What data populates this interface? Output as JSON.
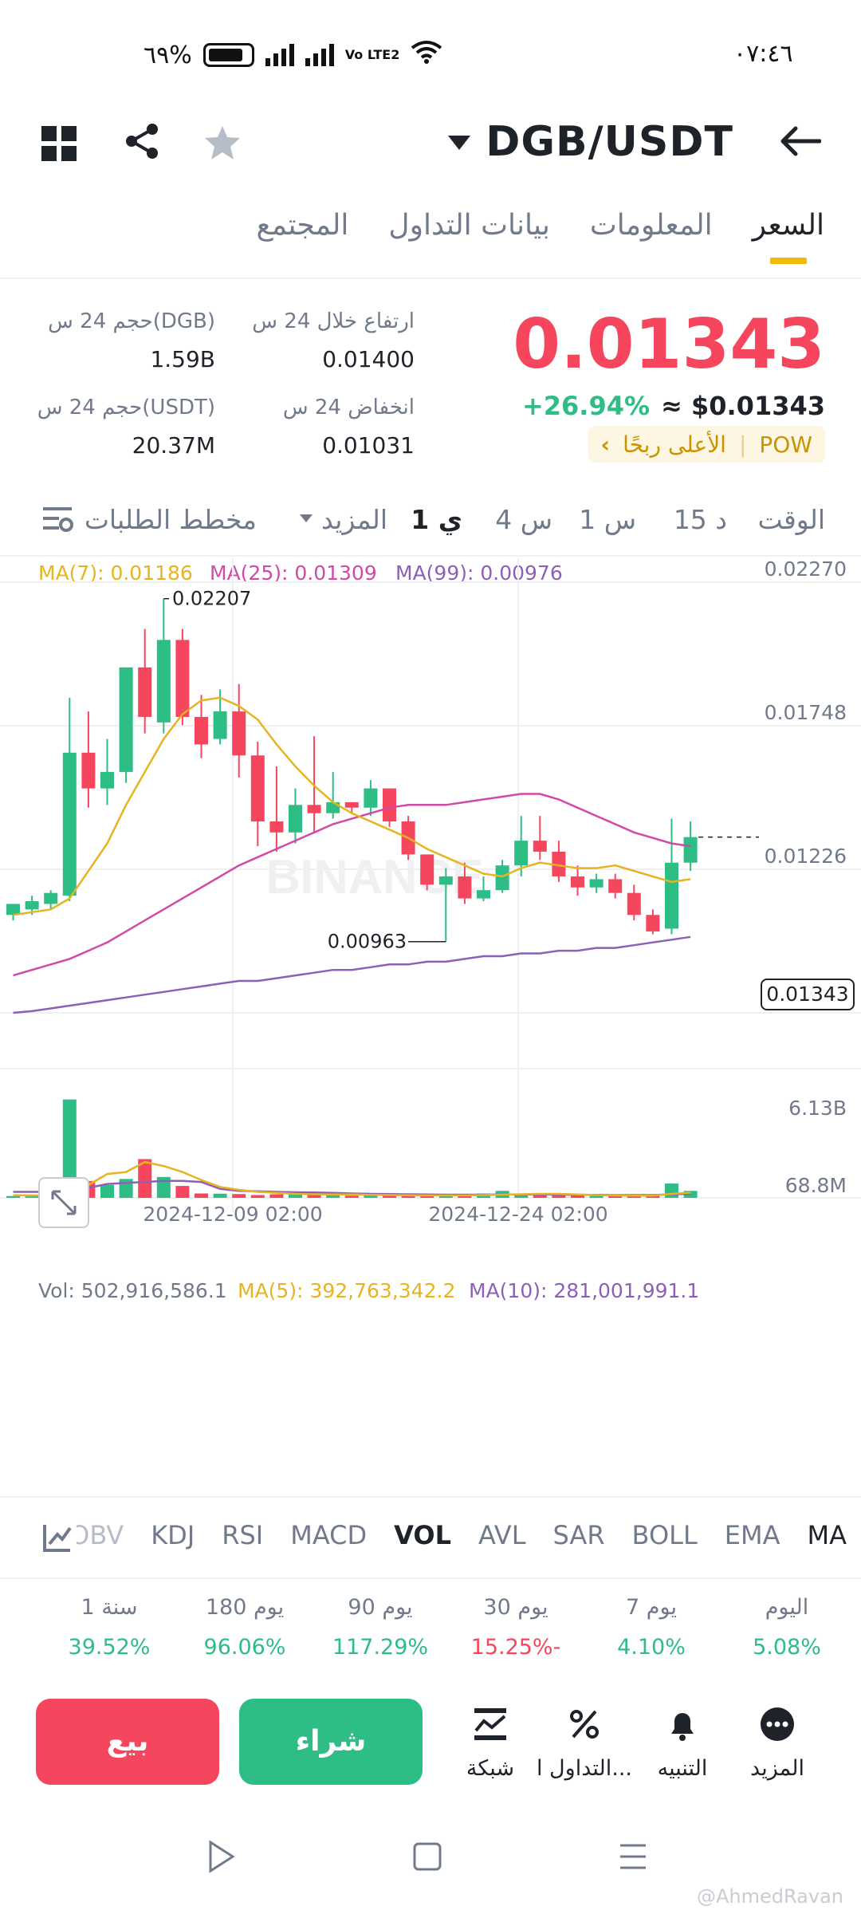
{
  "status_bar": {
    "time": "٠٧:٤٦",
    "battery": "٦٩%",
    "network": "Vo LTE2"
  },
  "header": {
    "pair": "DGB/USDT",
    "icons": [
      "back-arrow-icon",
      "dropdown-caret-icon",
      "favorite-star-icon",
      "share-icon",
      "grid-menu-icon"
    ]
  },
  "tabs": [
    {
      "label": "السعر",
      "active": true
    },
    {
      "label": "المعلومات",
      "active": false
    },
    {
      "label": "بيانات التداول",
      "active": false
    },
    {
      "label": "المجتمع",
      "active": false
    }
  ],
  "price": {
    "last": "0.01343",
    "change_pct": "+26.94%",
    "usd": "≈ $0.01343",
    "tag_pow": "POW",
    "tag_gainers": "الأعلى ربحًا",
    "tag_arrow": "‹"
  },
  "stats": {
    "high_label": "ارتفاع خلال 24 س",
    "high_value": "0.01400",
    "low_label": "انخفاض 24 س",
    "low_value": "0.01031",
    "vol_base_label": "حجم 24 س(DGB)",
    "vol_base_value": "1.59B",
    "vol_quote_label": "حجم 24 س(USDT)",
    "vol_quote_value": "20.37M"
  },
  "timeframes": {
    "label": "الوقت",
    "items": [
      "15 د",
      "1 س",
      "4 س",
      "1 ي"
    ],
    "active": "1 ي",
    "more": "المزيد",
    "depth": "مخطط الطلبات"
  },
  "ma_legend": {
    "ma7": "MA(7): 0.01186",
    "ma25": "MA(25): 0.01309",
    "ma99": "MA(99): 0.00976"
  },
  "vol_legend": {
    "vol": "Vol: 502,916,586.1",
    "ma5": "MA(5): 392,763,342.2",
    "ma10": "MA(10): 281,001,991.1"
  },
  "colors": {
    "up": "#2ebd85",
    "down": "#f6465d",
    "ma7": "#e6b422",
    "ma25": "#d04aa6",
    "ma99": "#8e5fb8",
    "accent": "#f0b90b"
  },
  "chart_data": {
    "type": "candlestick",
    "y_axis_ticks": [
      "0.02270",
      "0.01748",
      "0.01226",
      "0.00704"
    ],
    "ylim": [
      0.00704,
      0.0227
    ],
    "x_ticks": [
      "2024-12-09 02:00",
      "2024-12-24 02:00"
    ],
    "annotations": {
      "max": "0.02207",
      "min": "0.00963"
    },
    "last_price_tag": "0.01343",
    "candles": [
      {
        "o": 0.0106,
        "h": 0.011,
        "c": 0.011,
        "l": 0.0104
      },
      {
        "o": 0.0108,
        "h": 0.0113,
        "c": 0.0111,
        "l": 0.0106
      },
      {
        "o": 0.011,
        "h": 0.0115,
        "c": 0.0114,
        "l": 0.0108
      },
      {
        "o": 0.0113,
        "h": 0.0185,
        "c": 0.0165,
        "l": 0.0111
      },
      {
        "o": 0.0165,
        "h": 0.018,
        "c": 0.0152,
        "l": 0.0145
      },
      {
        "o": 0.0152,
        "h": 0.017,
        "c": 0.0158,
        "l": 0.0146
      },
      {
        "o": 0.0158,
        "h": 0.0196,
        "c": 0.0196,
        "l": 0.0154
      },
      {
        "o": 0.0196,
        "h": 0.021,
        "c": 0.0178,
        "l": 0.0172
      },
      {
        "o": 0.0176,
        "h": 0.0221,
        "c": 0.0206,
        "l": 0.0172
      },
      {
        "o": 0.0206,
        "h": 0.021,
        "c": 0.0178,
        "l": 0.0175
      },
      {
        "o": 0.0178,
        "h": 0.0186,
        "c": 0.0168,
        "l": 0.0163
      },
      {
        "o": 0.017,
        "h": 0.0188,
        "c": 0.018,
        "l": 0.0168
      },
      {
        "o": 0.018,
        "h": 0.019,
        "c": 0.0164,
        "l": 0.0156
      },
      {
        "o": 0.0164,
        "h": 0.0169,
        "c": 0.014,
        "l": 0.0131
      },
      {
        "o": 0.014,
        "h": 0.016,
        "c": 0.0136,
        "l": 0.0129
      },
      {
        "o": 0.0136,
        "h": 0.0152,
        "c": 0.0146,
        "l": 0.0132
      },
      {
        "o": 0.0146,
        "h": 0.0171,
        "c": 0.0143,
        "l": 0.0136
      },
      {
        "o": 0.0143,
        "h": 0.0158,
        "c": 0.0147,
        "l": 0.0141
      },
      {
        "o": 0.0147,
        "h": 0.0146,
        "c": 0.0145,
        "l": 0.0143
      },
      {
        "o": 0.0145,
        "h": 0.0155,
        "c": 0.0152,
        "l": 0.0142
      },
      {
        "o": 0.0152,
        "h": 0.0152,
        "c": 0.014,
        "l": 0.0138
      },
      {
        "o": 0.014,
        "h": 0.0142,
        "c": 0.0128,
        "l": 0.0126
      },
      {
        "o": 0.0128,
        "h": 0.0127,
        "c": 0.0117,
        "l": 0.0115
      },
      {
        "o": 0.0117,
        "h": 0.0123,
        "c": 0.012,
        "l": 0.00963
      },
      {
        "o": 0.012,
        "h": 0.0125,
        "c": 0.0112,
        "l": 0.011
      },
      {
        "o": 0.0112,
        "h": 0.012,
        "c": 0.0115,
        "l": 0.0111
      },
      {
        "o": 0.0115,
        "h": 0.0126,
        "c": 0.0124,
        "l": 0.0114
      },
      {
        "o": 0.0124,
        "h": 0.0142,
        "c": 0.0133,
        "l": 0.012
      },
      {
        "o": 0.0133,
        "h": 0.0142,
        "c": 0.0129,
        "l": 0.0126
      },
      {
        "o": 0.0129,
        "h": 0.0133,
        "c": 0.012,
        "l": 0.0118
      },
      {
        "o": 0.012,
        "h": 0.0124,
        "c": 0.0116,
        "l": 0.0113
      },
      {
        "o": 0.0116,
        "h": 0.0121,
        "c": 0.0119,
        "l": 0.0114
      },
      {
        "o": 0.0119,
        "h": 0.0121,
        "c": 0.0114,
        "l": 0.0112
      },
      {
        "o": 0.0114,
        "h": 0.0117,
        "c": 0.0106,
        "l": 0.0104
      },
      {
        "o": 0.0106,
        "h": 0.0108,
        "c": 0.01,
        "l": 0.0099
      },
      {
        "o": 0.0101,
        "h": 0.0141,
        "c": 0.0125,
        "l": 0.0099
      },
      {
        "o": 0.0125,
        "h": 0.014,
        "c": 0.01343,
        "l": 0.0122
      }
    ],
    "ma7": [
      0.0106,
      0.0107,
      0.0108,
      0.0112,
      0.0122,
      0.0132,
      0.0146,
      0.0158,
      0.017,
      0.0179,
      0.0184,
      0.0185,
      0.0182,
      0.0177,
      0.0168,
      0.016,
      0.0153,
      0.0147,
      0.0143,
      0.014,
      0.0137,
      0.0134,
      0.013,
      0.0127,
      0.0124,
      0.0121,
      0.012,
      0.0123,
      0.0125,
      0.0124,
      0.0123,
      0.0123,
      0.0124,
      0.0122,
      0.012,
      0.0118,
      0.0119
    ],
    "ma25": [
      0.0084,
      0.0086,
      0.0088,
      0.009,
      0.0093,
      0.0096,
      0.01,
      0.0104,
      0.0108,
      0.0112,
      0.0116,
      0.012,
      0.0124,
      0.0127,
      0.013,
      0.0133,
      0.0136,
      0.0139,
      0.0141,
      0.0143,
      0.0145,
      0.0146,
      0.0146,
      0.0146,
      0.0147,
      0.0148,
      0.0149,
      0.015,
      0.015,
      0.0148,
      0.0145,
      0.0142,
      0.0139,
      0.0136,
      0.0134,
      0.0132,
      0.0131
    ],
    "ma99": [
      0.00704,
      0.0071,
      0.0072,
      0.0073,
      0.0074,
      0.0075,
      0.0076,
      0.0077,
      0.0078,
      0.0079,
      0.008,
      0.0081,
      0.0082,
      0.0082,
      0.0083,
      0.0084,
      0.0085,
      0.0086,
      0.0086,
      0.0087,
      0.0088,
      0.0088,
      0.0089,
      0.0089,
      0.009,
      0.0091,
      0.0091,
      0.0092,
      0.0092,
      0.0093,
      0.0093,
      0.0094,
      0.0094,
      0.0095,
      0.0096,
      0.0097,
      0.0098
    ],
    "volume": {
      "ticks": [
        "6.13B",
        "68.8M"
      ],
      "ylim": [
        0,
        6.3
      ],
      "values": [
        0.09,
        0.09,
        0.08,
        4.95,
        0.85,
        0.65,
        0.95,
        1.95,
        1.05,
        0.6,
        0.22,
        0.21,
        0.19,
        0.14,
        0.18,
        0.17,
        0.24,
        0.14,
        0.11,
        0.14,
        0.11,
        0.1,
        0.1,
        0.15,
        0.1,
        0.22,
        0.35,
        0.22,
        0.18,
        0.13,
        0.11,
        0.11,
        0.1,
        0.11,
        0.1,
        0.72,
        0.35
      ],
      "ma5": [
        0.13,
        0.12,
        0.12,
        0.55,
        0.65,
        1.2,
        1.3,
        1.8,
        1.6,
        1.3,
        0.9,
        0.55,
        0.4,
        0.3,
        0.25,
        0.2,
        0.18,
        0.17,
        0.17,
        0.15,
        0.14,
        0.13,
        0.12,
        0.12,
        0.12,
        0.14,
        0.16,
        0.18,
        0.2,
        0.2,
        0.17,
        0.14,
        0.12,
        0.11,
        0.11,
        0.2,
        0.26
      ],
      "ma10": [
        0.3,
        0.3,
        0.3,
        0.3,
        0.5,
        0.7,
        0.75,
        0.8,
        0.85,
        0.85,
        0.8,
        0.45,
        0.35,
        0.33,
        0.3,
        0.28,
        0.27,
        0.25,
        0.22,
        0.2,
        0.19,
        0.18,
        0.17,
        0.16,
        0.16,
        0.16,
        0.17,
        0.17,
        0.17,
        0.16,
        0.15,
        0.15,
        0.14,
        0.14,
        0.14,
        0.18,
        0.2
      ]
    }
  },
  "indicators": [
    "MA",
    "EMA",
    "BOLL",
    "SAR",
    "AVL",
    "VOL",
    "MACD",
    "RSI",
    "KDJ",
    "OBV"
  ],
  "indicator_active": "VOL",
  "performance": [
    {
      "label": "اليوم",
      "value": "5.08%",
      "color": "#2ebd85"
    },
    {
      "label": "7 يوم",
      "value": "4.10%",
      "color": "#2ebd85"
    },
    {
      "label": "30 يوم",
      "value": "15.25%-",
      "color": "#f6465d"
    },
    {
      "label": "90 يوم",
      "value": "117.29%",
      "color": "#2ebd85"
    },
    {
      "label": "180 يوم",
      "value": "96.06%",
      "color": "#2ebd85"
    },
    {
      "label": "1 سنة",
      "value": "39.52%",
      "color": "#2ebd85"
    }
  ],
  "actions": {
    "sell": "بيع",
    "buy": "شراء",
    "grid": "شبكة",
    "trading": "التداول ا...",
    "alert": "التنبيه",
    "more": "المزيد"
  },
  "chart_watermark": "BINANCE",
  "watermark": "@AhmedRavan"
}
